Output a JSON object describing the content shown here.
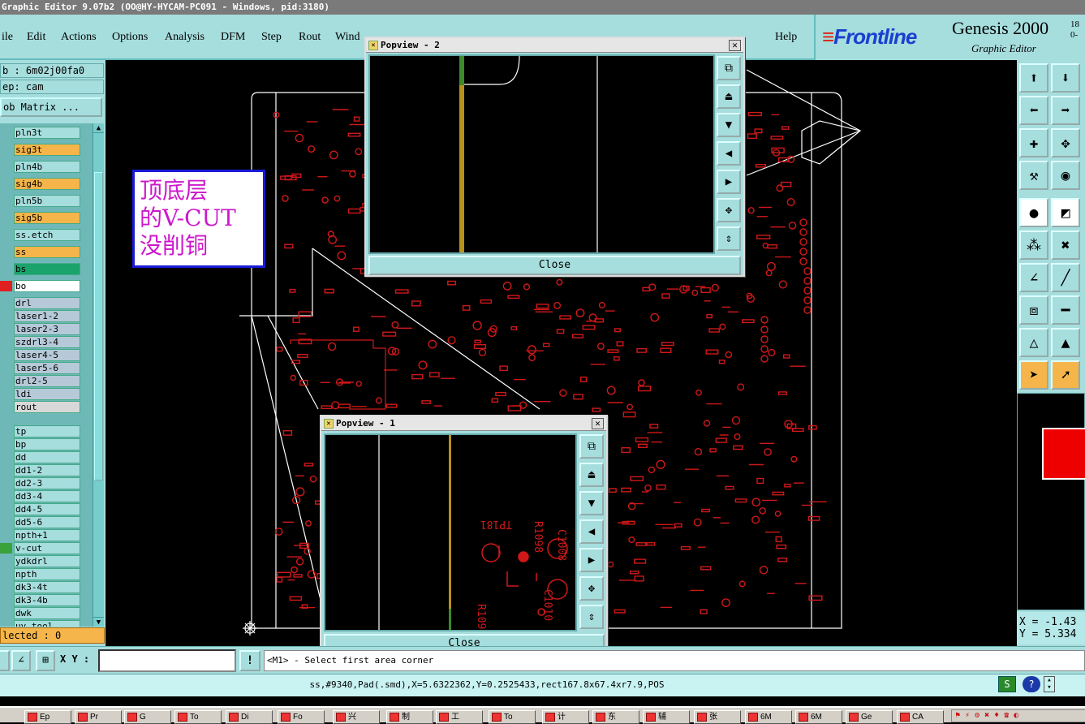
{
  "window_title": "Graphic Editor 9.07b2 (OO@HY-HYCAM-PC091 - Windows, pid:3180)",
  "menu": [
    "ile",
    "Edit",
    "Actions",
    "Options",
    "Analysis",
    "DFM",
    "Step",
    "Rout",
    "Wind",
    "Help"
  ],
  "logo": {
    "brand": "Frontline",
    "product": "Genesis 2000",
    "sub": "Graphic Editor",
    "ver1": "18",
    "ver2": "0-"
  },
  "job": {
    "job_line": "b : 6m02j00fa0",
    "step_line": "ep: cam",
    "matrix_button": "ob Matrix ..."
  },
  "layers": [
    {
      "name": "pln3t",
      "color": "#a6dddd"
    },
    {
      "name": "sig3t",
      "color": "#f5b54a"
    },
    {
      "name": "pln4b",
      "color": "#a6dddd"
    },
    {
      "name": "sig4b",
      "color": "#f5b54a"
    },
    {
      "name": "pln5b",
      "color": "#a6dddd"
    },
    {
      "name": "sig5b",
      "color": "#f5b54a"
    },
    {
      "name": "ss.etch",
      "color": "#a6dddd"
    },
    {
      "name": "ss",
      "color": "#f5b54a"
    },
    {
      "name": "bs",
      "color": "#1aa36b"
    },
    {
      "name": "bo",
      "color": "#ffffff",
      "swatch": "#e02020"
    },
    {
      "name": "drl",
      "color": "#b5c9d8"
    },
    {
      "name": "laser1-2",
      "color": "#b5c9d8"
    },
    {
      "name": "laser2-3",
      "color": "#b5c9d8"
    },
    {
      "name": "szdrl3-4",
      "color": "#b5c9d8"
    },
    {
      "name": "laser4-5",
      "color": "#b5c9d8"
    },
    {
      "name": "laser5-6",
      "color": "#b5c9d8"
    },
    {
      "name": "drl2-5",
      "color": "#b5c9d8"
    },
    {
      "name": "ldi",
      "color": "#b5c9d8"
    },
    {
      "name": "rout",
      "color": "#d8d8d8"
    },
    {
      "name": "tp",
      "color": "#a6dddd"
    },
    {
      "name": "bp",
      "color": "#a6dddd"
    },
    {
      "name": "dd",
      "color": "#a6dddd"
    },
    {
      "name": "dd1-2",
      "color": "#a6dddd"
    },
    {
      "name": "dd2-3",
      "color": "#a6dddd"
    },
    {
      "name": "dd3-4",
      "color": "#a6dddd"
    },
    {
      "name": "dd4-5",
      "color": "#a6dddd"
    },
    {
      "name": "dd5-6",
      "color": "#a6dddd"
    },
    {
      "name": "npth+1",
      "color": "#a6dddd"
    },
    {
      "name": "v-cut",
      "color": "#a6dddd",
      "swatch": "#3aa23a"
    },
    {
      "name": "ydkdrl",
      "color": "#a6dddd"
    },
    {
      "name": "npth",
      "color": "#a6dddd"
    },
    {
      "name": "dk3-4t",
      "color": "#a6dddd"
    },
    {
      "name": "dk3-4b",
      "color": "#a6dddd"
    },
    {
      "name": "dwk",
      "color": "#a6dddd"
    },
    {
      "name": "uv_tool",
      "color": "#a6dddd"
    }
  ],
  "selected_text": "lected : 0",
  "xy_label": "X Y :",
  "prompt_text": "<M1> - Select first area corner",
  "status_text": "ss,#9340,Pad(.smd),X=5.6322362,Y=0.2525433,rect167.8x67.4xr7.9,POS",
  "coords": {
    "x": "X = -1.43",
    "y": "Y = 5.334"
  },
  "callout_lines": [
    "顶底层",
    "的V-CUT",
    "没削铜"
  ],
  "popup2": {
    "title": "Popview - 2",
    "close": "Close"
  },
  "popup1": {
    "title": "Popview - 1",
    "close": "Close"
  },
  "popup1_labels": {
    "tp": "TP181",
    "r1": "R1098",
    "r2": "R1097",
    "c1": "C1008",
    "c2": "C1010"
  },
  "taskbar": [
    "Ep",
    "Pr",
    "G",
    "To",
    "Di",
    "Fo",
    "兴",
    "制",
    "工",
    "To",
    "计",
    "东",
    "辅",
    "张",
    "6M",
    "6M",
    "Ge",
    "CA"
  ],
  "colors": {
    "panel": "#a6dddd",
    "layer_active": "#f5b54a",
    "pcb_red": "#d01818"
  }
}
